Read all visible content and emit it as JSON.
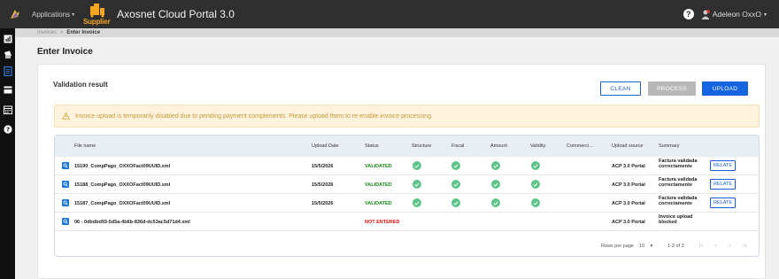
{
  "topbar": {
    "apps_label": "Applications",
    "supplier_label": "Supplier",
    "title": "Axosnet Cloud Portal 3.0",
    "help": "?",
    "user": "Adeleon OxxO"
  },
  "breadcrumb": {
    "parent": "Invoices",
    "separator": "»",
    "current": "Enter Invoice"
  },
  "page": {
    "title": "Enter Invoice",
    "section_title": "Validation result"
  },
  "buttons": {
    "clean": "CLEAN",
    "process": "PROCESS",
    "upload": "UPLOAD"
  },
  "alert": {
    "text": "Invoice upload is temporarily disabled due to pending payment complements. Please upload them to re-enable invoice processing."
  },
  "table": {
    "headers": {
      "file": "File name",
      "date": "Upload Date",
      "status": "Status",
      "structure": "Structure",
      "fiscal": "Fiscal",
      "amount": "Amount",
      "validity": "Validity",
      "commercial": "Commerci...",
      "source": "Upload source",
      "summary": "Summary"
    },
    "rows": [
      {
        "file": "15190_CompPago_OXXOFact09UUID.xml",
        "date": "15/5/2026",
        "status": "VALIDATED",
        "source": "ACP 3.0 Portal",
        "summary": "Factura validada correctamente",
        "action": "RELATE"
      },
      {
        "file": "15188_CompPago_OXXOFact09UUID.xml",
        "date": "15/5/2026",
        "status": "VALIDATED",
        "source": "ACP 3.0 Portal",
        "summary": "Factura validada correctamente",
        "action": "RELATE"
      },
      {
        "file": "15187_CompPago_OXXOFact09UUID.xml",
        "date": "15/5/2026",
        "status": "VALIDATED",
        "source": "ACP 3.0 Portal",
        "summary": "Factura validada correctamente",
        "action": "RELATE"
      },
      {
        "file": "06 - 0dbdbd93-5d5a-4b6b-836d-dc53ac5d71d4.xml",
        "date": "",
        "status": "NOT ENTERED",
        "source": "ACP 3.0 Portal",
        "summary": "Invoice upload blocked",
        "action": ""
      }
    ],
    "footer": {
      "rows_per_page_label": "Rows per page",
      "rows_per_page_value": "10",
      "range": "1-3 of 3"
    }
  },
  "colors": {
    "accent": "#1565e0",
    "validated": "#1a8a1a",
    "not_entered": "#e01010",
    "check": "#5fc38a",
    "alert_bg": "#fdf2dc"
  }
}
